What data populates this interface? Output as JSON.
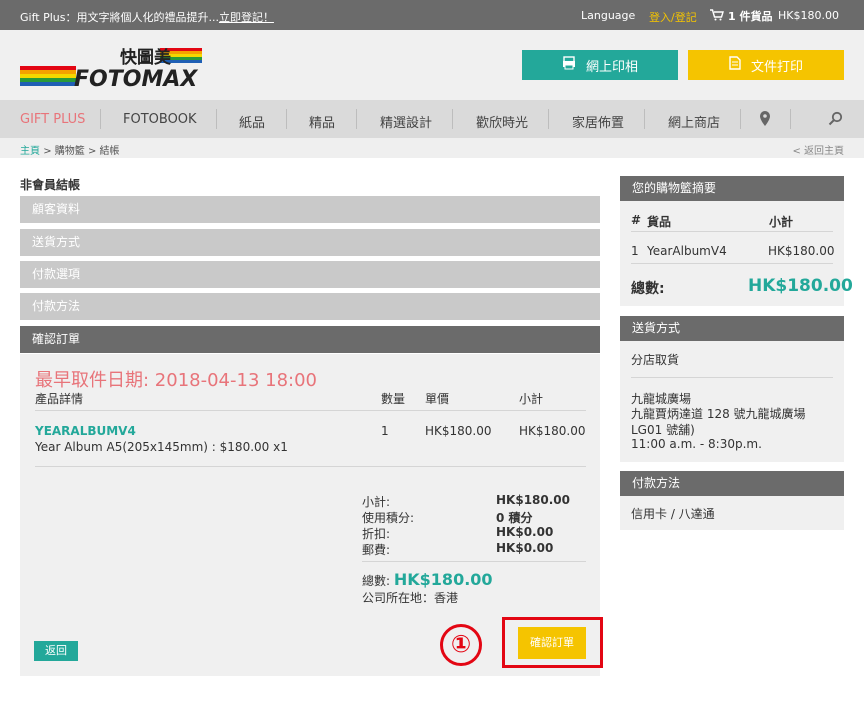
{
  "topbar": {
    "promo": "Gift Plus：用文字將個人化的禮品提升...",
    "register_link": "立即登記！",
    "language": "Language",
    "login": "登入/登記",
    "cart_count": "1 件貨品",
    "cart_amount": "HK$180.00"
  },
  "header": {
    "brand_chinese": "快圖美",
    "brand": "FOTOMAX",
    "btn_online_print": "網上印相",
    "btn_doc_print": "文件打印"
  },
  "nav": {
    "items": [
      "GIFT PLUS",
      "FOTOBOOK",
      "紙品",
      "精品",
      "精選設計",
      "歡欣時光",
      "家居佈置",
      "網上商店"
    ]
  },
  "breadcrumb": {
    "home": "主頁",
    "cart": "購物籃",
    "checkout": "結帳",
    "sep": ">",
    "back": "< 返回主頁"
  },
  "checkout": {
    "title": "非會員結帳",
    "steps": [
      "顧客資料",
      "送貨方式",
      "付款選項",
      "付款方法",
      "確認訂單"
    ]
  },
  "order": {
    "pickup": "最早取件日期: 2018-04-13 18:00",
    "headers": {
      "product": "產品詳情",
      "qty": "數量",
      "price": "單價",
      "subtotal": "小計"
    },
    "item": {
      "name": "YEARALBUMV4",
      "desc": "Year Album A5(205x145mm) : $180.00 x1",
      "qty": "1",
      "price": "HK$180.00",
      "subtotal": "HK$180.00"
    },
    "summary": {
      "subtotal_label": "小計:",
      "subtotal": "HK$180.00",
      "points_label": "使用積分:",
      "points": "0 積分",
      "discount_label": "折扣:",
      "discount": "HK$0.00",
      "postage_label": "郵費:",
      "postage": "HK$0.00",
      "total_label": "總數:",
      "total": "HK$180.00",
      "company": "公司所在地：香港"
    },
    "back_button": "返回",
    "confirm_button": "確認訂單",
    "marker": "①"
  },
  "cart_summary": {
    "title": "您的購物籃摘要",
    "col_num": "#",
    "col_item": "貨品",
    "col_subtotal": "小計",
    "row_num": "1",
    "row_item": "YearAlbumV4",
    "row_subtotal": "HK$180.00",
    "total_label": "總數:",
    "total": "HK$180.00"
  },
  "delivery": {
    "title": "送貨方式",
    "method": "分店取貨",
    "branch": "九龍城廣場",
    "address1": "九龍賈炳達道 128 號九龍城廣場",
    "address2": "LG01 號舖)",
    "hours": "11:00 a.m. - 8:30p.m."
  },
  "payment": {
    "title": "付款方法",
    "method": "信用卡 / 八達通"
  },
  "colors": {
    "teal": "#23a89a",
    "yellow": "#f5c400",
    "pink": "#e8747a",
    "highlight_red": "#e30613"
  }
}
